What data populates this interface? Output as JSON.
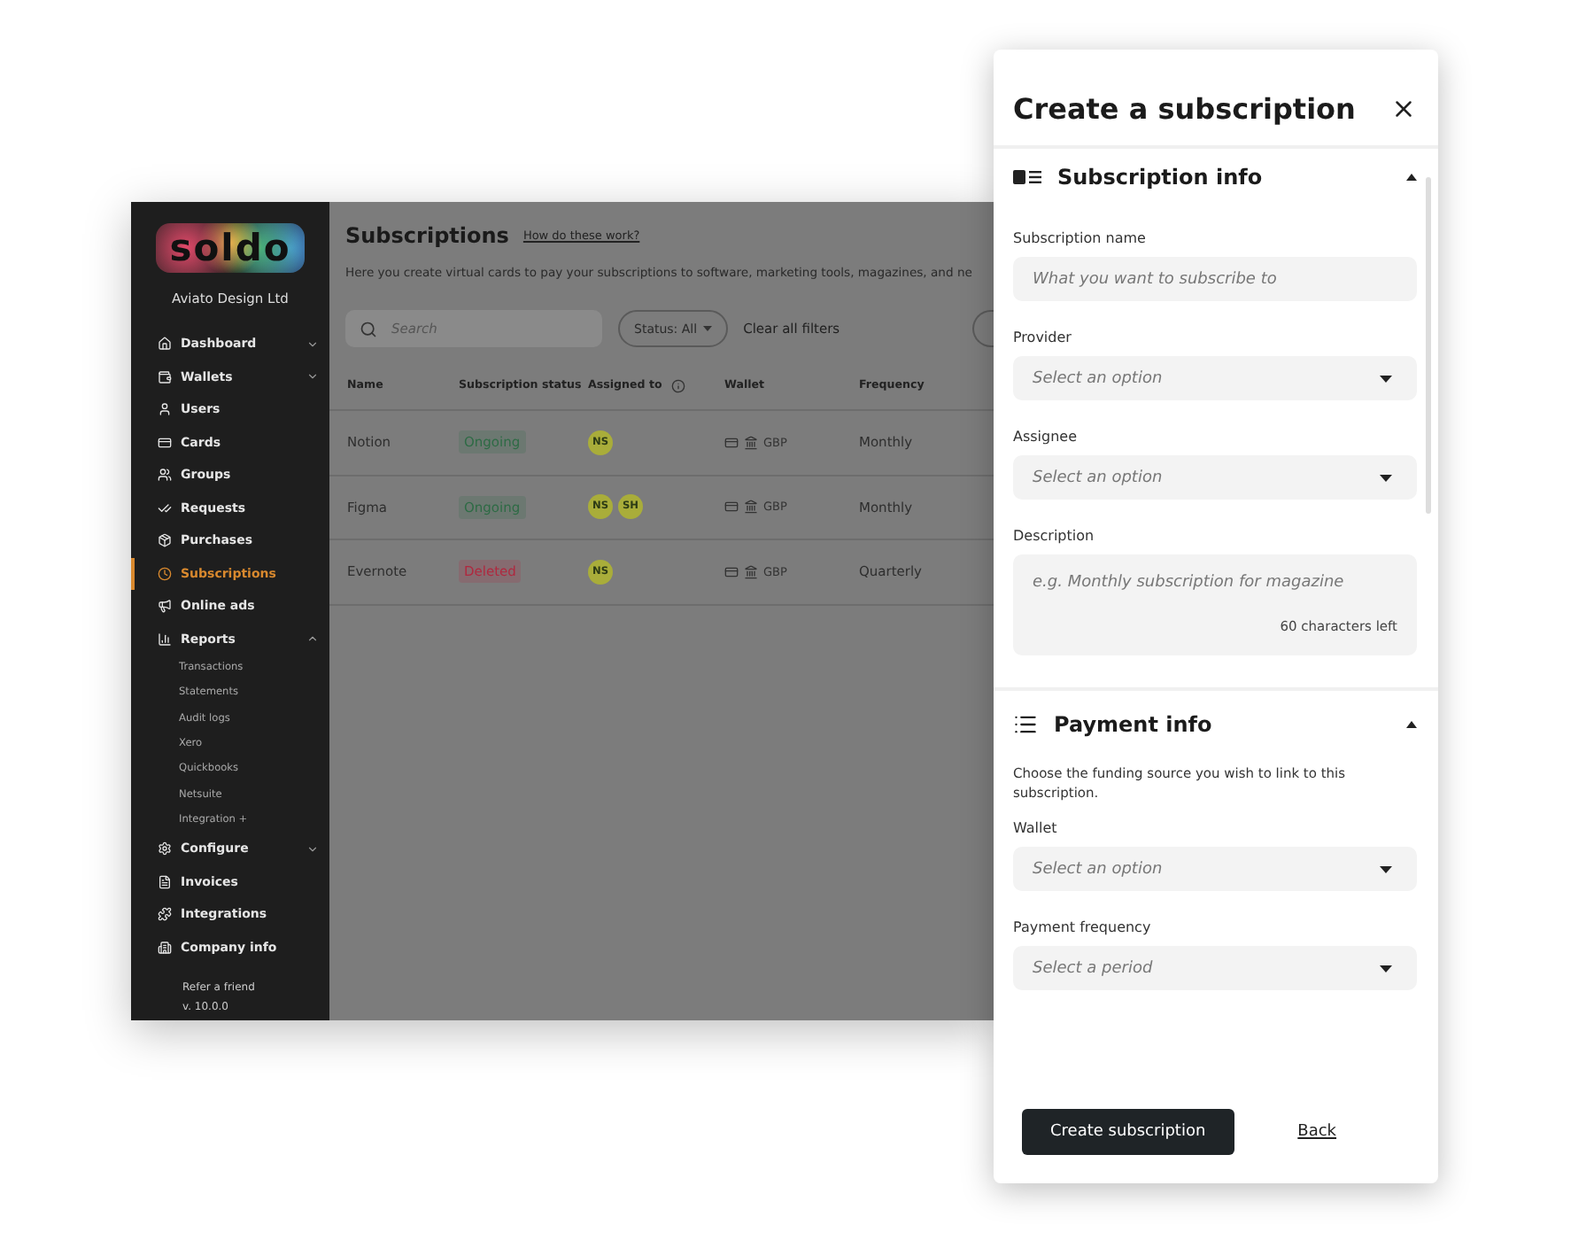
{
  "sidebar": {
    "logo": "soldo",
    "company": "Aviato Design Ltd",
    "items": [
      {
        "label": "Dashboard",
        "selected": false,
        "expanded": false
      },
      {
        "label": "Wallets",
        "selected": false,
        "expanded": false
      },
      {
        "label": "Users",
        "selected": false
      },
      {
        "label": "Cards",
        "selected": false
      },
      {
        "label": "Groups",
        "selected": false
      },
      {
        "label": "Requests",
        "selected": false
      },
      {
        "label": "Purchases",
        "selected": false
      },
      {
        "label": "Subscriptions",
        "selected": true
      },
      {
        "label": "Online ads",
        "selected": false
      },
      {
        "label": "Reports",
        "selected": false,
        "expanded": true,
        "children": [
          {
            "label": "Transactions"
          },
          {
            "label": "Statements"
          },
          {
            "label": "Audit logs"
          },
          {
            "label": "Xero"
          },
          {
            "label": "Quickbooks"
          },
          {
            "label": "Netsuite"
          },
          {
            "label": "Integration +"
          }
        ]
      },
      {
        "label": "Configure",
        "selected": false,
        "expanded": false
      },
      {
        "label": "Invoices",
        "selected": false
      },
      {
        "label": "Integrations",
        "selected": false
      },
      {
        "label": "Company info",
        "selected": false
      }
    ],
    "footer": [
      "Refer a friend",
      "v. 10.0.0"
    ]
  },
  "main": {
    "title": "Subscriptions",
    "help_link": "How do these work?",
    "description": "Here you create virtual cards to pay your subscriptions to software, marketing tools, magazines, and ne",
    "search": {
      "placeholder": "Search"
    },
    "status_filter": "Status: All",
    "clear_filters": "Clear all filters",
    "table": {
      "columns": [
        "Name",
        "Subscription status",
        "Assigned to",
        "Wallet",
        "Frequency"
      ],
      "rows": [
        {
          "name": "Notion",
          "status": {
            "label": "Ongoing",
            "color": "#2e6b45"
          },
          "assignees": [
            "NS"
          ],
          "currency": "GBP",
          "frequency": "Monthly"
        },
        {
          "name": "Figma",
          "status": {
            "label": "Ongoing",
            "color": "#2e6b45"
          },
          "assignees": [
            "NS",
            "SH"
          ],
          "currency": "GBP",
          "frequency": "Monthly"
        },
        {
          "name": "Evernote",
          "status": {
            "label": "Deleted",
            "color": "#b0283f"
          },
          "assignees": [
            "NS"
          ],
          "currency": "GBP",
          "frequency": "Quarterly"
        }
      ]
    }
  },
  "panel": {
    "title": "Create a subscription",
    "sections": [
      {
        "title": "Subscription info",
        "expanded": true,
        "fields": [
          {
            "kind": "text",
            "label": "Subscription name",
            "placeholder": "What you want to subscribe to"
          },
          {
            "kind": "select",
            "label": "Provider",
            "placeholder": "Select an option"
          },
          {
            "kind": "select",
            "label": "Assignee",
            "placeholder": "Select an option"
          },
          {
            "kind": "textarea",
            "label": "Description",
            "placeholder": "e.g. Monthly subscription for magazine",
            "counter": "60 characters left"
          }
        ]
      },
      {
        "title": "Payment info",
        "expanded": true,
        "help": "Choose the funding source you wish to link to this subscription.",
        "fields": [
          {
            "kind": "select",
            "label": "Wallet",
            "placeholder": "Select an option"
          },
          {
            "kind": "select",
            "label": "Payment frequency",
            "placeholder": "Select a period"
          }
        ]
      }
    ],
    "primary_button": "Create subscription",
    "secondary_button": "Back"
  }
}
